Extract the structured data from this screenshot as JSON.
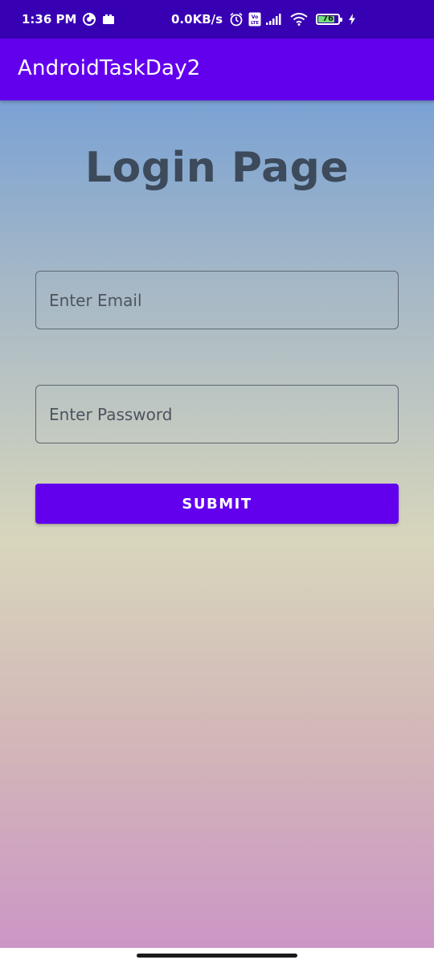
{
  "status_bar": {
    "time": "1:36 PM",
    "network_speed": "0.0KB/s",
    "battery_level": "76",
    "icons": [
      "data-saver-icon",
      "camera-icon",
      "alarm-icon",
      "volte-icon",
      "signal-icon",
      "wifi-icon",
      "battery-icon",
      "charging-icon"
    ]
  },
  "app_bar": {
    "title": "AndroidTaskDay2"
  },
  "login": {
    "title": "Login Page",
    "email_placeholder": "Enter Email",
    "email_value": "",
    "password_placeholder": "Enter Password",
    "password_value": "",
    "submit_label": "SUBMIT"
  },
  "colors": {
    "status_bar": "#3700b3",
    "app_bar": "#6200ee",
    "button": "#6200ee",
    "title_text": "#3c4a5b",
    "gradient_top": "#7aa2d4",
    "gradient_middle": "#d8d6bc",
    "gradient_bottom": "#cc96c5"
  }
}
